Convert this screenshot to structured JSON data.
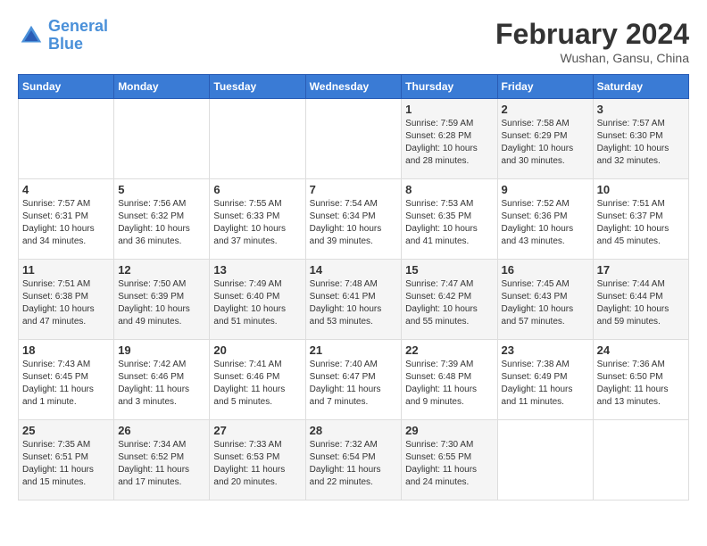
{
  "header": {
    "logo_line1": "General",
    "logo_line2": "Blue",
    "month_year": "February 2024",
    "location": "Wushan, Gansu, China"
  },
  "weekdays": [
    "Sunday",
    "Monday",
    "Tuesday",
    "Wednesday",
    "Thursday",
    "Friday",
    "Saturday"
  ],
  "weeks": [
    [
      {
        "day": "",
        "detail": ""
      },
      {
        "day": "",
        "detail": ""
      },
      {
        "day": "",
        "detail": ""
      },
      {
        "day": "",
        "detail": ""
      },
      {
        "day": "1",
        "detail": "Sunrise: 7:59 AM\nSunset: 6:28 PM\nDaylight: 10 hours\nand 28 minutes."
      },
      {
        "day": "2",
        "detail": "Sunrise: 7:58 AM\nSunset: 6:29 PM\nDaylight: 10 hours\nand 30 minutes."
      },
      {
        "day": "3",
        "detail": "Sunrise: 7:57 AM\nSunset: 6:30 PM\nDaylight: 10 hours\nand 32 minutes."
      }
    ],
    [
      {
        "day": "4",
        "detail": "Sunrise: 7:57 AM\nSunset: 6:31 PM\nDaylight: 10 hours\nand 34 minutes."
      },
      {
        "day": "5",
        "detail": "Sunrise: 7:56 AM\nSunset: 6:32 PM\nDaylight: 10 hours\nand 36 minutes."
      },
      {
        "day": "6",
        "detail": "Sunrise: 7:55 AM\nSunset: 6:33 PM\nDaylight: 10 hours\nand 37 minutes."
      },
      {
        "day": "7",
        "detail": "Sunrise: 7:54 AM\nSunset: 6:34 PM\nDaylight: 10 hours\nand 39 minutes."
      },
      {
        "day": "8",
        "detail": "Sunrise: 7:53 AM\nSunset: 6:35 PM\nDaylight: 10 hours\nand 41 minutes."
      },
      {
        "day": "9",
        "detail": "Sunrise: 7:52 AM\nSunset: 6:36 PM\nDaylight: 10 hours\nand 43 minutes."
      },
      {
        "day": "10",
        "detail": "Sunrise: 7:51 AM\nSunset: 6:37 PM\nDaylight: 10 hours\nand 45 minutes."
      }
    ],
    [
      {
        "day": "11",
        "detail": "Sunrise: 7:51 AM\nSunset: 6:38 PM\nDaylight: 10 hours\nand 47 minutes."
      },
      {
        "day": "12",
        "detail": "Sunrise: 7:50 AM\nSunset: 6:39 PM\nDaylight: 10 hours\nand 49 minutes."
      },
      {
        "day": "13",
        "detail": "Sunrise: 7:49 AM\nSunset: 6:40 PM\nDaylight: 10 hours\nand 51 minutes."
      },
      {
        "day": "14",
        "detail": "Sunrise: 7:48 AM\nSunset: 6:41 PM\nDaylight: 10 hours\nand 53 minutes."
      },
      {
        "day": "15",
        "detail": "Sunrise: 7:47 AM\nSunset: 6:42 PM\nDaylight: 10 hours\nand 55 minutes."
      },
      {
        "day": "16",
        "detail": "Sunrise: 7:45 AM\nSunset: 6:43 PM\nDaylight: 10 hours\nand 57 minutes."
      },
      {
        "day": "17",
        "detail": "Sunrise: 7:44 AM\nSunset: 6:44 PM\nDaylight: 10 hours\nand 59 minutes."
      }
    ],
    [
      {
        "day": "18",
        "detail": "Sunrise: 7:43 AM\nSunset: 6:45 PM\nDaylight: 11 hours\nand 1 minute."
      },
      {
        "day": "19",
        "detail": "Sunrise: 7:42 AM\nSunset: 6:46 PM\nDaylight: 11 hours\nand 3 minutes."
      },
      {
        "day": "20",
        "detail": "Sunrise: 7:41 AM\nSunset: 6:46 PM\nDaylight: 11 hours\nand 5 minutes."
      },
      {
        "day": "21",
        "detail": "Sunrise: 7:40 AM\nSunset: 6:47 PM\nDaylight: 11 hours\nand 7 minutes."
      },
      {
        "day": "22",
        "detail": "Sunrise: 7:39 AM\nSunset: 6:48 PM\nDaylight: 11 hours\nand 9 minutes."
      },
      {
        "day": "23",
        "detail": "Sunrise: 7:38 AM\nSunset: 6:49 PM\nDaylight: 11 hours\nand 11 minutes."
      },
      {
        "day": "24",
        "detail": "Sunrise: 7:36 AM\nSunset: 6:50 PM\nDaylight: 11 hours\nand 13 minutes."
      }
    ],
    [
      {
        "day": "25",
        "detail": "Sunrise: 7:35 AM\nSunset: 6:51 PM\nDaylight: 11 hours\nand 15 minutes."
      },
      {
        "day": "26",
        "detail": "Sunrise: 7:34 AM\nSunset: 6:52 PM\nDaylight: 11 hours\nand 17 minutes."
      },
      {
        "day": "27",
        "detail": "Sunrise: 7:33 AM\nSunset: 6:53 PM\nDaylight: 11 hours\nand 20 minutes."
      },
      {
        "day": "28",
        "detail": "Sunrise: 7:32 AM\nSunset: 6:54 PM\nDaylight: 11 hours\nand 22 minutes."
      },
      {
        "day": "29",
        "detail": "Sunrise: 7:30 AM\nSunset: 6:55 PM\nDaylight: 11 hours\nand 24 minutes."
      },
      {
        "day": "",
        "detail": ""
      },
      {
        "day": "",
        "detail": ""
      }
    ]
  ]
}
